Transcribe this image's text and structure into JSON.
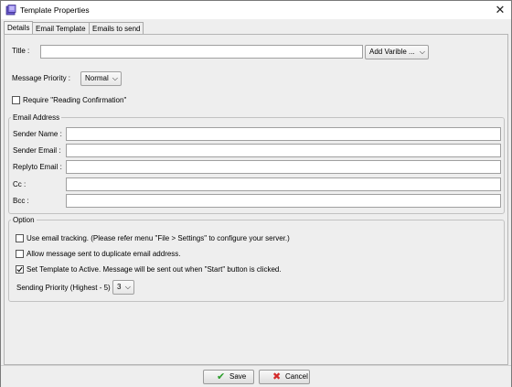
{
  "window": {
    "title": "Template Properties",
    "close_glyph": "✕"
  },
  "tabs": [
    {
      "label": "Details",
      "active": true
    },
    {
      "label": "Email Template",
      "active": false
    },
    {
      "label": "Emails to send",
      "active": false
    }
  ],
  "details": {
    "title_label": "Title :",
    "title_value": "",
    "add_variable_label": "Add Varible ...",
    "priority_label": "Message Priority :",
    "priority_value": "Normal",
    "reading_confirmation_label": "Require \"Reading Confirmation\"",
    "reading_confirmation_checked": false
  },
  "email_address": {
    "group_title": "Email Address",
    "fields": [
      {
        "label": "Sender Name :",
        "value": ""
      },
      {
        "label": "Sender Email :",
        "value": ""
      },
      {
        "label": "Replyto Email :",
        "value": ""
      },
      {
        "label": "Cc :",
        "value": ""
      },
      {
        "label": "Bcc :",
        "value": ""
      }
    ]
  },
  "option": {
    "group_title": "Option",
    "tracking_label": "Use email tracking. (Please refer menu \"File > Settings\" to configure your server.)",
    "tracking_checked": false,
    "duplicate_label": "Allow message sent to duplicate email address.",
    "duplicate_checked": false,
    "active_label": "Set Template to Active. Message will be sent out when \"Start\" button is clicked.",
    "active_checked": true,
    "sending_priority_label": "Sending Priority (Highest - 5) :",
    "sending_priority_value": "3"
  },
  "buttons": {
    "save_label": "Save",
    "cancel_label": "Cancel"
  },
  "icons": {
    "app": "template-app-icon",
    "save": "check-mark-icon",
    "cancel": "red-x-icon",
    "dropdown": "chevron-down-icon"
  },
  "colors": {
    "save_icon": "#2a9d2a",
    "cancel_icon": "#d42a2a",
    "window_bg": "#eeeeee"
  }
}
